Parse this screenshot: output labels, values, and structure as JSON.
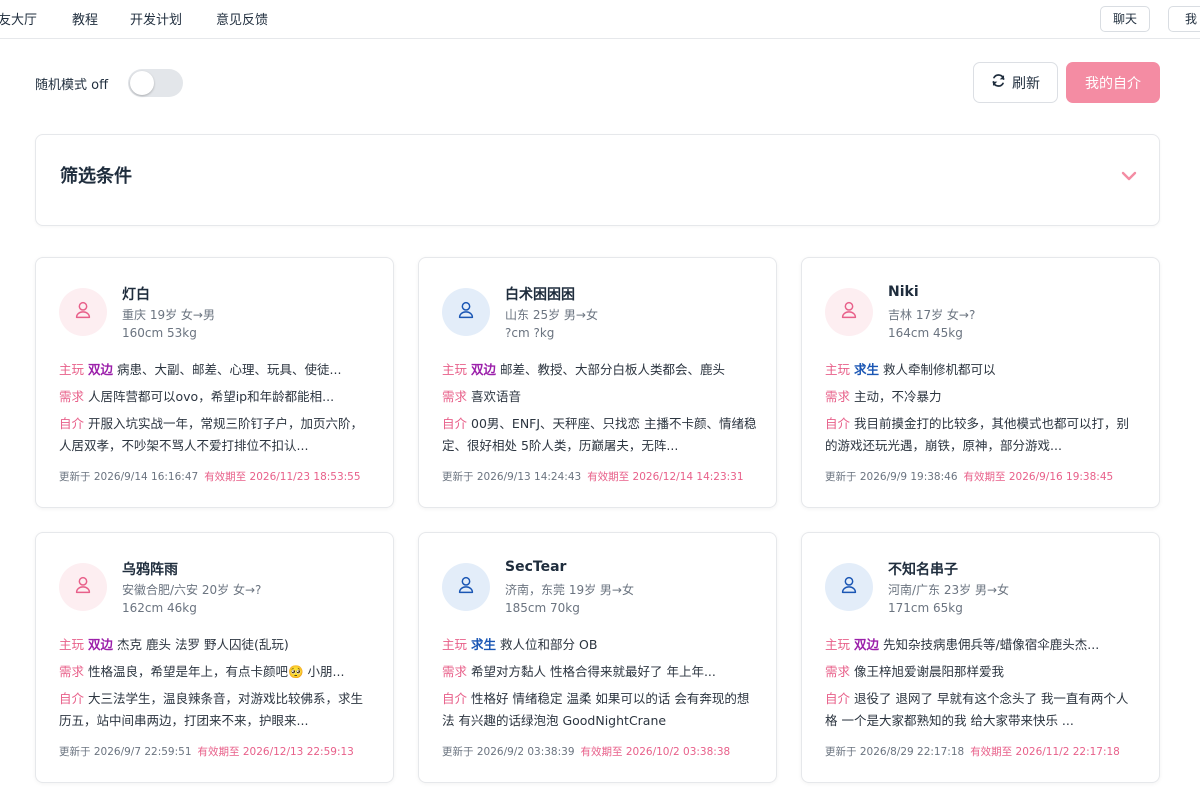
{
  "nav": {
    "items": [
      "友大厅",
      "教程",
      "开发计划",
      "意见反馈"
    ],
    "chat_label": "聊天",
    "cut_label": "我"
  },
  "controls": {
    "random_mode_label": "随机模式 off",
    "refresh_label": "刷新",
    "my_intro_label": "我的自介"
  },
  "filter": {
    "title": "筛选条件"
  },
  "labels": {
    "play": "主玩",
    "need": "需求",
    "intro": "自介",
    "updated": "更新于",
    "expires": "有效期至"
  },
  "colors": {
    "accent_pink": "#f48ca3",
    "tag_both": "#9b1faa",
    "tag_seek": "#1a56b4"
  },
  "cards": [
    {
      "gender": "female",
      "name": "灯白",
      "meta1": "重庆 19岁 女→男",
      "meta2": "160cm 53kg",
      "tag": "双边",
      "tag_type": "both",
      "play": "病患、大副、邮差、心理、玩具、使徒...",
      "need": "人居阵营都可以ovo，希望ip和年龄都能相...",
      "intro": "开服入坑实战一年，常规三阶钉子户，加页六阶，人居双孝，不吵架不骂人不爱打排位不扣认...",
      "updated": "2026/9/14 16:16:47",
      "expires": "2026/11/23 18:53:55"
    },
    {
      "gender": "male",
      "name": "白术困困困",
      "meta1": "山东 25岁 男→女",
      "meta2": "?cm ?kg",
      "tag": "双边",
      "tag_type": "both",
      "play": "邮差、教授、大部分白板人类都会、鹿头",
      "need": "喜欢语音",
      "intro": "00男、ENFJ、天秤座、只找恋 主播不卡颜、情绪稳定、很好相处 5阶人类，历巅屠夫，无阵...",
      "updated": "2026/9/13 14:24:43",
      "expires": "2026/12/14 14:23:31"
    },
    {
      "gender": "female",
      "name": "Niki",
      "meta1": "吉林 17岁 女→?",
      "meta2": "164cm 45kg",
      "tag": "求生",
      "tag_type": "seek",
      "play": "救人牵制修机都可以",
      "need": "主动，不冷暴力",
      "intro": "我目前摸金打的比较多，其他模式也都可以打，别的游戏还玩光遇，崩铁，原神，部分游戏...",
      "updated": "2026/9/9 19:38:46",
      "expires": "2026/9/16 19:38:45"
    },
    {
      "gender": "female",
      "name": "乌鸦阵雨",
      "meta1": "安徽合肥/六安 20岁 女→?",
      "meta2": "162cm 46kg",
      "tag": "双边",
      "tag_type": "both",
      "play": "杰克 鹿头 法罗 野人囚徒(乱玩)",
      "need": "性格温良，希望是年上，有点卡颜吧🥺 小朋...",
      "intro": "大三法学生，温良辣条音，对游戏比较佛系，求生历五，站中间串两边，打团来不来，护眼来...",
      "updated": "2026/9/7 22:59:51",
      "expires": "2026/12/13 22:59:13"
    },
    {
      "gender": "male",
      "name": "SecTear",
      "meta1": "济南，东莞 19岁 男→女",
      "meta2": "185cm 70kg",
      "tag": "求生",
      "tag_type": "seek",
      "play": "救人位和部分 OB",
      "need": "希望对方黏人 性格合得来就最好了 年上年...",
      "intro": "性格好 情绪稳定 温柔 如果可以的话 会有奔现的想法 有兴趣的话绿泡泡 GoodNightCrane",
      "updated": "2026/9/2 03:38:39",
      "expires": "2026/10/2 03:38:38"
    },
    {
      "gender": "male",
      "name": "不知名串子",
      "meta1": "河南/广东 23岁 男→女",
      "meta2": "171cm 65kg",
      "tag": "双边",
      "tag_type": "both",
      "play": "先知杂技病患佣兵等/蜡像宿伞鹿头杰...",
      "need": "像王梓旭爱谢晨阳那样爱我",
      "intro": "退役了 退网了 早就有这个念头了 我一直有两个人格 一个是大家都熟知的我 给大家带来快乐 ...",
      "updated": "2026/8/29 22:17:18",
      "expires": "2026/11/2 22:17:18"
    }
  ]
}
